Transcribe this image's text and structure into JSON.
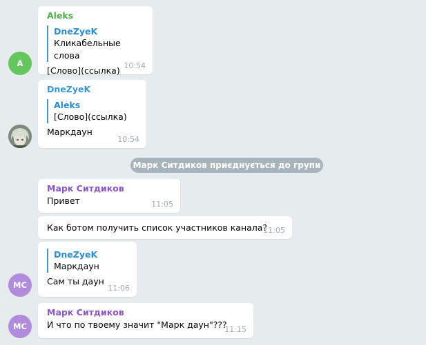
{
  "messages": [
    {
      "sender": "Aleks",
      "sender_color": "#4fae4e",
      "reply_to": {
        "name": "DneZyeK",
        "text": "Кликабельные слова"
      },
      "text": "[Слово](ссылка)",
      "time": "10:54",
      "avatar": {
        "initials": "A",
        "color": "#65c55f"
      }
    },
    {
      "sender": "DneZyeK",
      "sender_color": "#3a95d5",
      "reply_to": {
        "name": "Aleks",
        "text": "[Слово](ссылка)"
      },
      "text": "Маркдаун",
      "time": "10:54",
      "avatar": {
        "type": "photo",
        "icon": "anime-character-avatar"
      }
    },
    {
      "service": "Марк Ситдиков приєднується до групи"
    },
    {
      "sender": "Марк Ситдиков",
      "sender_color": "#8e55c4",
      "text": "Привет",
      "time": "11:05"
    },
    {
      "text": "Как ботом получить список участников канала?",
      "time": "11:05"
    },
    {
      "reply_to": {
        "name": "DneZyeK",
        "text": "Маркдаун"
      },
      "text": "Сам ты даун",
      "time": "11:06",
      "avatar": {
        "initials": "МС",
        "color": "#b18cdc"
      }
    },
    {
      "sender": "Марк Ситдиков",
      "sender_color": "#8e55c4",
      "text": "И что по твоему значит \"Марк даун\"???",
      "time": "11:15",
      "avatar": {
        "initials": "МС",
        "color": "#b18cdc"
      }
    }
  ]
}
